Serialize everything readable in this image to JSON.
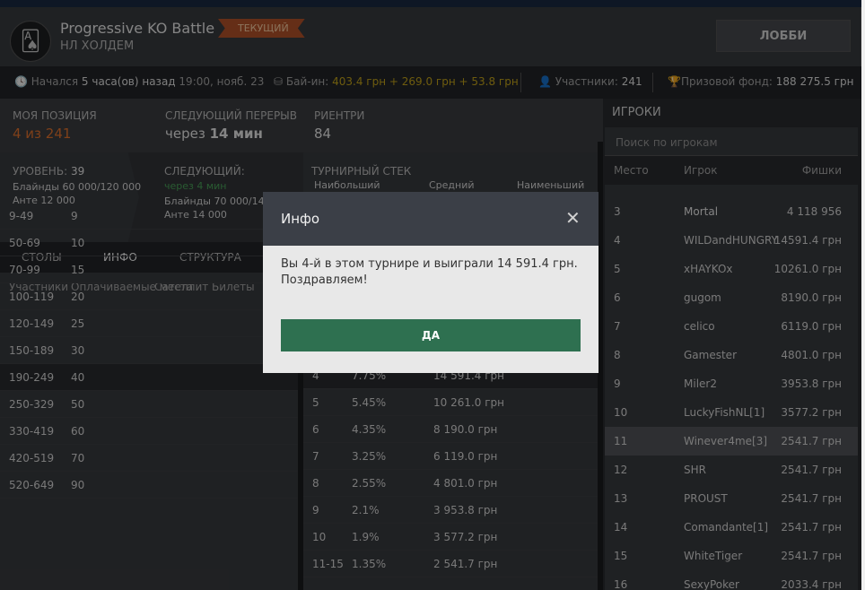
{
  "header": {
    "title": "Progressive KO Battle",
    "subtitle": "НЛ ХОЛДЕМ",
    "badge": "ТЕКУЩИЙ",
    "lobby": "ЛОББИ",
    "logo_icon": "cards-icon"
  },
  "infobar": {
    "started_label": "Начался",
    "started_value": "5 часа(ов) назад",
    "started_time": "19:00, нояб. 23",
    "buyin_label": "Бай-ин:",
    "buyin_value": "403.4 грн + 269.0 грн + 53.8 грн",
    "players_label": "Участники:",
    "players_value": "241",
    "prize_label": "Призовой фонд:",
    "prize_value": "188 275.5 грн"
  },
  "status": {
    "position_label": "МОЯ ПОЗИЦИЯ",
    "position_value": "4 из 241",
    "break_label": "СЛЕДУЮЩИЙ ПЕРЕРЫВ",
    "break_prefix": "через",
    "break_value": "14 мин",
    "rebuys_label": "РИЕНТРИ",
    "rebuys_value": "84"
  },
  "level": {
    "level_label": "УРОВЕНЬ:",
    "level_value": "39",
    "blinds": "Блайнды 60 000/120 000",
    "ante": "Анте 12 000",
    "next_label": "СЛЕДУЮЩИЙ:",
    "next_time": "через 4 мин",
    "next_blinds": "Блайнды 70 000/140 0",
    "next_ante": "Анте 14 000",
    "stack_label": "ТУРНИРНЫЙ СТЕК",
    "stack_max": "Наибольший",
    "stack_avg": "Средний",
    "stack_min": "Наименьший"
  },
  "tabs": [
    "СТОЛЫ",
    "ИНФО",
    "СТРУКТУРА"
  ],
  "payout_table": {
    "headers": [
      "Участники",
      "Оплачиваемые места",
      "Сателлит Билеты"
    ],
    "rows": [
      [
        "9-49",
        "9"
      ],
      [
        "50-69",
        "10"
      ],
      [
        "70-99",
        "15"
      ],
      [
        "100-119",
        "20"
      ],
      [
        "120-149",
        "25"
      ],
      [
        "150-189",
        "30"
      ],
      [
        "190-249",
        "40"
      ],
      [
        "250-329",
        "50"
      ],
      [
        "330-419",
        "60"
      ],
      [
        "420-519",
        "70"
      ],
      [
        "520-649",
        "90"
      ]
    ]
  },
  "prize_table": {
    "rows": [
      [
        "4",
        "7.75%",
        "14 591.4 грн"
      ],
      [
        "5",
        "5.45%",
        "10 261.0 грн"
      ],
      [
        "6",
        "4.35%",
        "8 190.0 грн"
      ],
      [
        "7",
        "3.25%",
        "6 119.0 грн"
      ],
      [
        "8",
        "2.55%",
        "4 801.0 грн"
      ],
      [
        "9",
        "2.1%",
        "3 953.8 грн"
      ],
      [
        "10",
        "1.9%",
        "3 577.2 грн"
      ],
      [
        "11-15",
        "1.35%",
        "2 541.7 грн"
      ]
    ]
  },
  "players": {
    "title": "ИГРОКИ",
    "search_placeholder": "Поиск по игрокам",
    "headers": [
      "Место",
      "Игрок",
      "Фишки"
    ],
    "rows": [
      [
        "3",
        "Mortal",
        "4 118 956"
      ],
      [
        "4",
        "WILDandHUNGRY",
        "14591.4 грн"
      ],
      [
        "5",
        "xHAYKOx",
        "10261.0 грн"
      ],
      [
        "6",
        "gugom",
        "8190.0 грн"
      ],
      [
        "7",
        "celico",
        "6119.0 грн"
      ],
      [
        "8",
        "Gamester",
        "4801.0 грн"
      ],
      [
        "9",
        "Miler2",
        "3953.8 грн"
      ],
      [
        "10",
        "LuckyFishNL[1]",
        "3577.2 грн"
      ],
      [
        "11",
        "Winever4me[3]",
        "2541.7 грн"
      ],
      [
        "12",
        "SHR",
        "2541.7 грн"
      ],
      [
        "13",
        "PROUST",
        "2541.7 грн"
      ],
      [
        "14",
        "Comandante[1]",
        "2541.7 грн"
      ],
      [
        "15",
        "WhiteTiger",
        "2541.7 грн"
      ],
      [
        "16",
        "SexyPoker",
        "2033.4 грн"
      ]
    ]
  },
  "modal": {
    "title": "Инфо",
    "close": "✕",
    "message": "Вы 4-й в этом турнире и выиграли 14 591.4 грн. Поздравляем!",
    "ok": "ДА"
  }
}
